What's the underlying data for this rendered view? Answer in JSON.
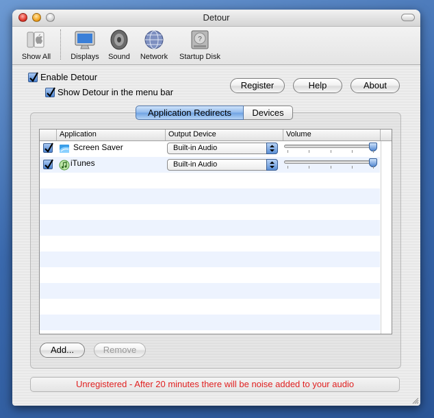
{
  "window": {
    "title": "Detour"
  },
  "toolbar": {
    "items": [
      {
        "label": "Show All",
        "icon": "apple-icon"
      },
      {
        "label": "Displays",
        "icon": "display-icon"
      },
      {
        "label": "Sound",
        "icon": "speaker-icon"
      },
      {
        "label": "Network",
        "icon": "network-globe-icon"
      },
      {
        "label": "Startup Disk",
        "icon": "hard-disk-icon"
      }
    ]
  },
  "options": {
    "enable_detour": {
      "label": "Enable Detour",
      "checked": true
    },
    "show_menu": {
      "label": "Show Detour in the menu bar",
      "checked": true
    }
  },
  "buttons": {
    "register": "Register",
    "help": "Help",
    "about": "About",
    "add": "Add...",
    "remove": "Remove"
  },
  "tabs": [
    {
      "label": "Application Redirects",
      "selected": true
    },
    {
      "label": "Devices",
      "selected": false
    }
  ],
  "table": {
    "columns": [
      "Application",
      "Output Device",
      "Volume"
    ],
    "rows": [
      {
        "checked": true,
        "app": "Screen Saver",
        "icon": "screen-saver-icon",
        "device": "Built-in Audio",
        "volume": 1.0
      },
      {
        "checked": true,
        "app": "iTunes",
        "icon": "itunes-icon",
        "device": "Built-in Audio",
        "volume": 1.0
      }
    ]
  },
  "status": {
    "text": "Unregistered - After 20 minutes there will be noise added to your audio",
    "color": "#e02020"
  },
  "colors": {
    "accent": "#5a8fd6",
    "row_alt": "#edf3fe"
  }
}
